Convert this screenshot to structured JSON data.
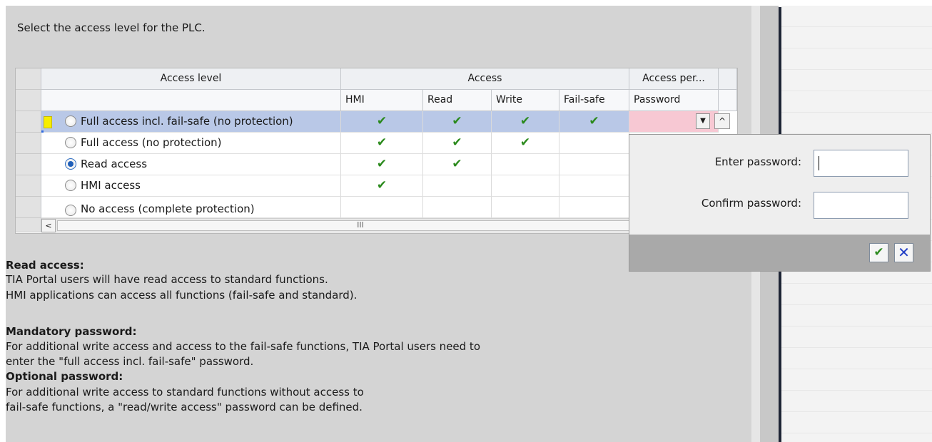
{
  "instruction": "Select the access level for the PLC.",
  "table": {
    "headers": {
      "access_level": "Access level",
      "access": "Access",
      "access_per": "Access per..."
    },
    "subheaders": {
      "hmi": "HMI",
      "read": "Read",
      "write": "Write",
      "failsafe": "Fail-safe",
      "password": "Password"
    },
    "rows": [
      {
        "label": "Full access incl. fail-safe (no protection)",
        "hmi": "✔",
        "read": "✔",
        "write": "✔",
        "failsafe": "✔",
        "selected_row": true,
        "radio_checked": false
      },
      {
        "label": "Full access (no protection)",
        "hmi": "✔",
        "read": "✔",
        "write": "✔",
        "failsafe": "",
        "selected_row": false,
        "radio_checked": false
      },
      {
        "label": "Read access",
        "hmi": "✔",
        "read": "✔",
        "write": "",
        "failsafe": "",
        "selected_row": false,
        "radio_checked": true
      },
      {
        "label": "HMI access",
        "hmi": "✔",
        "read": "",
        "write": "",
        "failsafe": "",
        "selected_row": false,
        "radio_checked": false
      },
      {
        "label": "No access (complete protection)",
        "hmi": "",
        "read": "",
        "write": "",
        "failsafe": "",
        "selected_row": false,
        "radio_checked": false
      }
    ],
    "scroll_left_glyph": "<",
    "scroll_thumb_glyph": "III",
    "dropdown_glyph": "▼",
    "up_glyph": "^"
  },
  "popup": {
    "enter_label": "Enter password:",
    "enter_value": "",
    "confirm_label": "Confirm password:",
    "confirm_value": "",
    "ok_glyph": "✔",
    "cancel_glyph": "✕"
  },
  "description": {
    "read_access_title": "Read access:",
    "read_access_line1": "TIA Portal users will have read  access to standard functions.",
    "read_access_line2": "HMI applications can access all functions (fail-safe and standard).",
    "mandatory_title": "Mandatory password:",
    "mandatory_line1": "For additional write access and access to the fail-safe functions, TIA Portal users need to",
    "mandatory_line2": "enter the \"full access incl. fail-safe\" password.",
    "optional_title": "Optional password:",
    "optional_line1": "For additional write access to standard functions without access to",
    "optional_line2": "fail-safe functions, a \"read/write access\" password can be defined."
  },
  "colors": {
    "selected_row": "#b9c8e7",
    "password_cell": "#f7c8d3",
    "checkmark": "#2b8a1d",
    "cancel": "#2440c6",
    "panel_bg": "#d4d4d4"
  }
}
